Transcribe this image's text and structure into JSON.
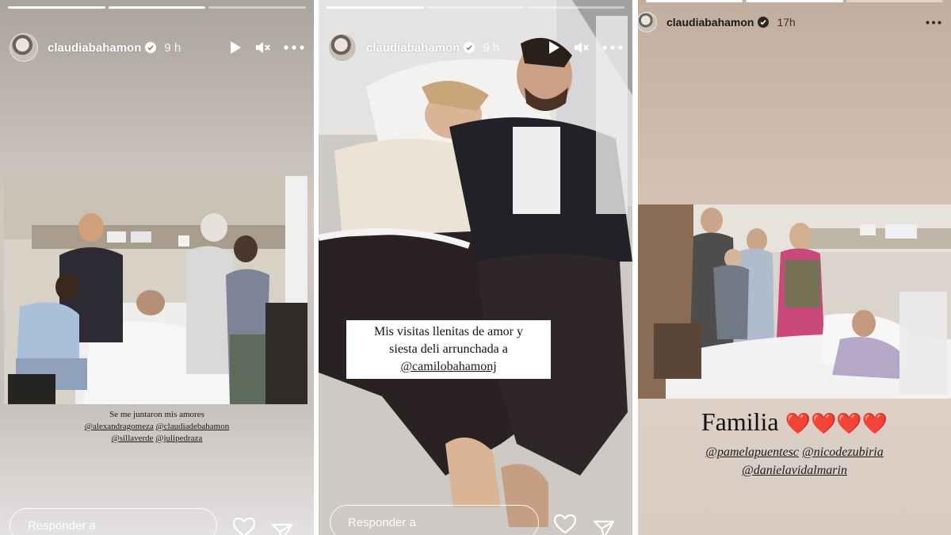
{
  "stories": [
    {
      "username": "claudiabahamon",
      "time": "9 h",
      "caption": {
        "line1": "Se me juntaron mis amores",
        "mention1": "@alexandragomeza",
        "mention2": "@claudiadebahamon",
        "mention3": "@sillaverde",
        "mention4": "@julipedraza"
      },
      "reply_placeholder": "Responder a"
    },
    {
      "username": "claudiabahamon",
      "time": "9 h",
      "caption": {
        "line1": "Mis visitas llenitas de amor y",
        "line2": "siesta deli arrunchada a",
        "mention": "@camilobahamonj"
      },
      "reply_placeholder": "Responder a"
    },
    {
      "username": "claudiabahamon",
      "time": "17h",
      "caption": {
        "title": "Familia",
        "hearts": "❤️❤️❤️❤️",
        "mention1": "@pamelapuentesc",
        "mention2": "@nicodezubiria",
        "mention3": "@danielavidalmarin"
      }
    }
  ],
  "colors": {
    "verified": "#3897f0",
    "heart": "#e02424"
  },
  "icons": [
    "play-icon",
    "mute-icon",
    "more-icon",
    "heart-icon",
    "send-icon",
    "verified-icon"
  ]
}
